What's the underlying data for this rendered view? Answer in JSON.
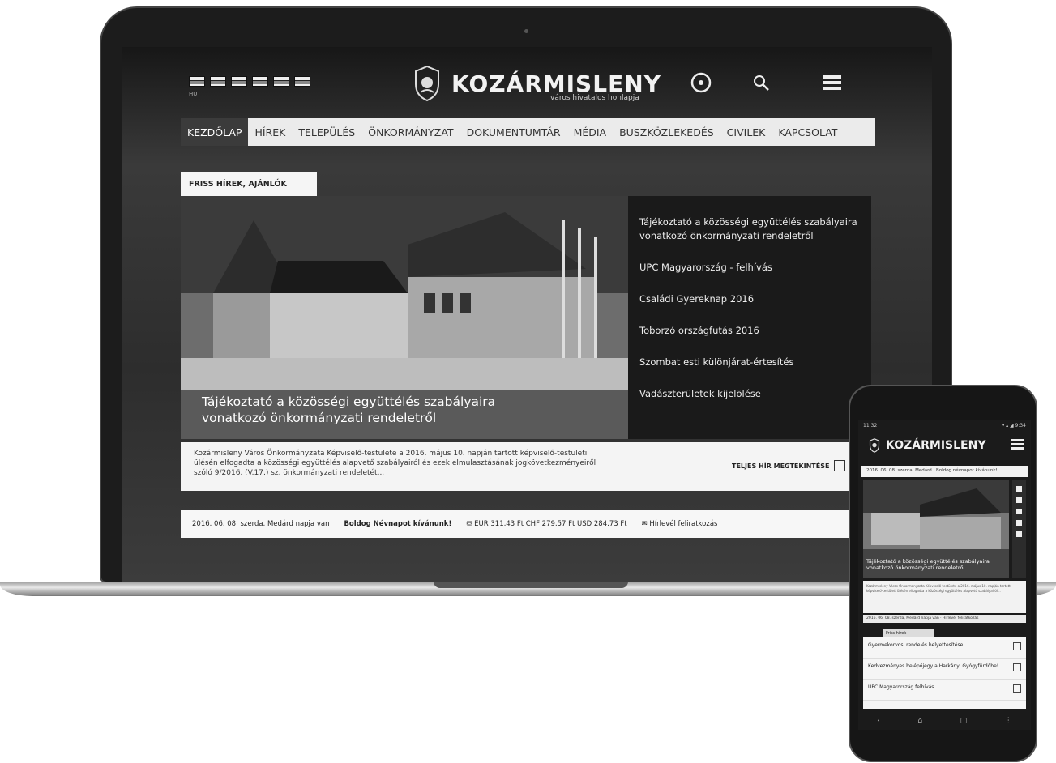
{
  "laptop": {
    "header": {
      "language_label": "HU",
      "logo_text": "KOZÁRMISLENY",
      "logo_subtitle": "város hivatalos honlapja",
      "icons": [
        "accessibility-icon",
        "search-icon",
        "menu-icon"
      ]
    },
    "nav": {
      "items": [
        "KEZDŐLAP",
        "HÍREK",
        "TELEPÜLÉS",
        "ÖNKORMÁNYZAT",
        "DOKUMENTUMTÁR",
        "MÉDIA",
        "BUSZKÖZLEKEDÉS",
        "CIVILEK",
        "KAPCSOLAT"
      ],
      "active": "KEZDŐLAP"
    },
    "featured": {
      "tab_label": "FRISS HÍREK, AJÁNLÓK",
      "caption": "Tájékoztató a közösségi együttélés szabályaira vonatkozó önkormányzati rendeletről",
      "news_list": [
        "Tájékoztató a közösségi együttélés szabályaira vonatkozó önkormányzati rendeletről",
        "UPC Magyarország - felhívás",
        "Családi Gyereknap 2016",
        "Toborzó országfutás 2016",
        "Szombat esti különjárat-értesítés",
        "Vadászterületek kijelölése"
      ],
      "excerpt": "Kozármisleny Város Önkormányzata Képviselő-testülete a 2016. május 10. napján tartott képviselő-testületi ülésén elfogadta a közösségi együttélés alapvető szabályairól és ezek elmulasztásának jogkövetkezményeiről szóló 9/2016. (V.17.) sz. önkormányzati rendeletét...",
      "more_label": "TELJES HÍR MEGTEKINTÉSE"
    },
    "ticker": {
      "date": "2016. 06. 08. szerda,",
      "nameday": "Medárd napja van",
      "greeting": "Boldog Névnapot kívánunk!",
      "rates": "EUR 311,43 Ft   CHF 279,57 Ft   USD 284,73 Ft",
      "newsletter": "Hírlevél feliratkozás"
    }
  },
  "phone": {
    "status_left": "11:32",
    "status_right": "▾ ▴ ◢ 9:34",
    "logo_text": "KOZÁRMISLENY",
    "date_bar": "2016. 06. 08. szerda, Medárd · Boldog névnapot kívánunk!",
    "caption": "Tájékoztató a közösségi együttélés szabályaira vonatkozó önkormányzati rendeletről",
    "excerpt": "Kozármisleny Város Önkormányzata Képviselő-testülete a 2016. május 10. napján tartott képviselő-testületi ülésén elfogadta a közösségi együttélés alapvető szabályairól...",
    "ticker": "2016. 06. 08. szerda, Medárd napja van",
    "ticker_right": "Hírlevél feliratkozás",
    "tab_label": "Friss hírek",
    "list": [
      "Gyermekorvosi rendelés helyettesítése",
      "Kedvezményes belépőjegy a Harkányi Gyógyfürdőbe!",
      "UPC Magyarország felhívás"
    ],
    "nav_icons": [
      "‹",
      "⌂",
      "▢",
      "⋮"
    ]
  }
}
